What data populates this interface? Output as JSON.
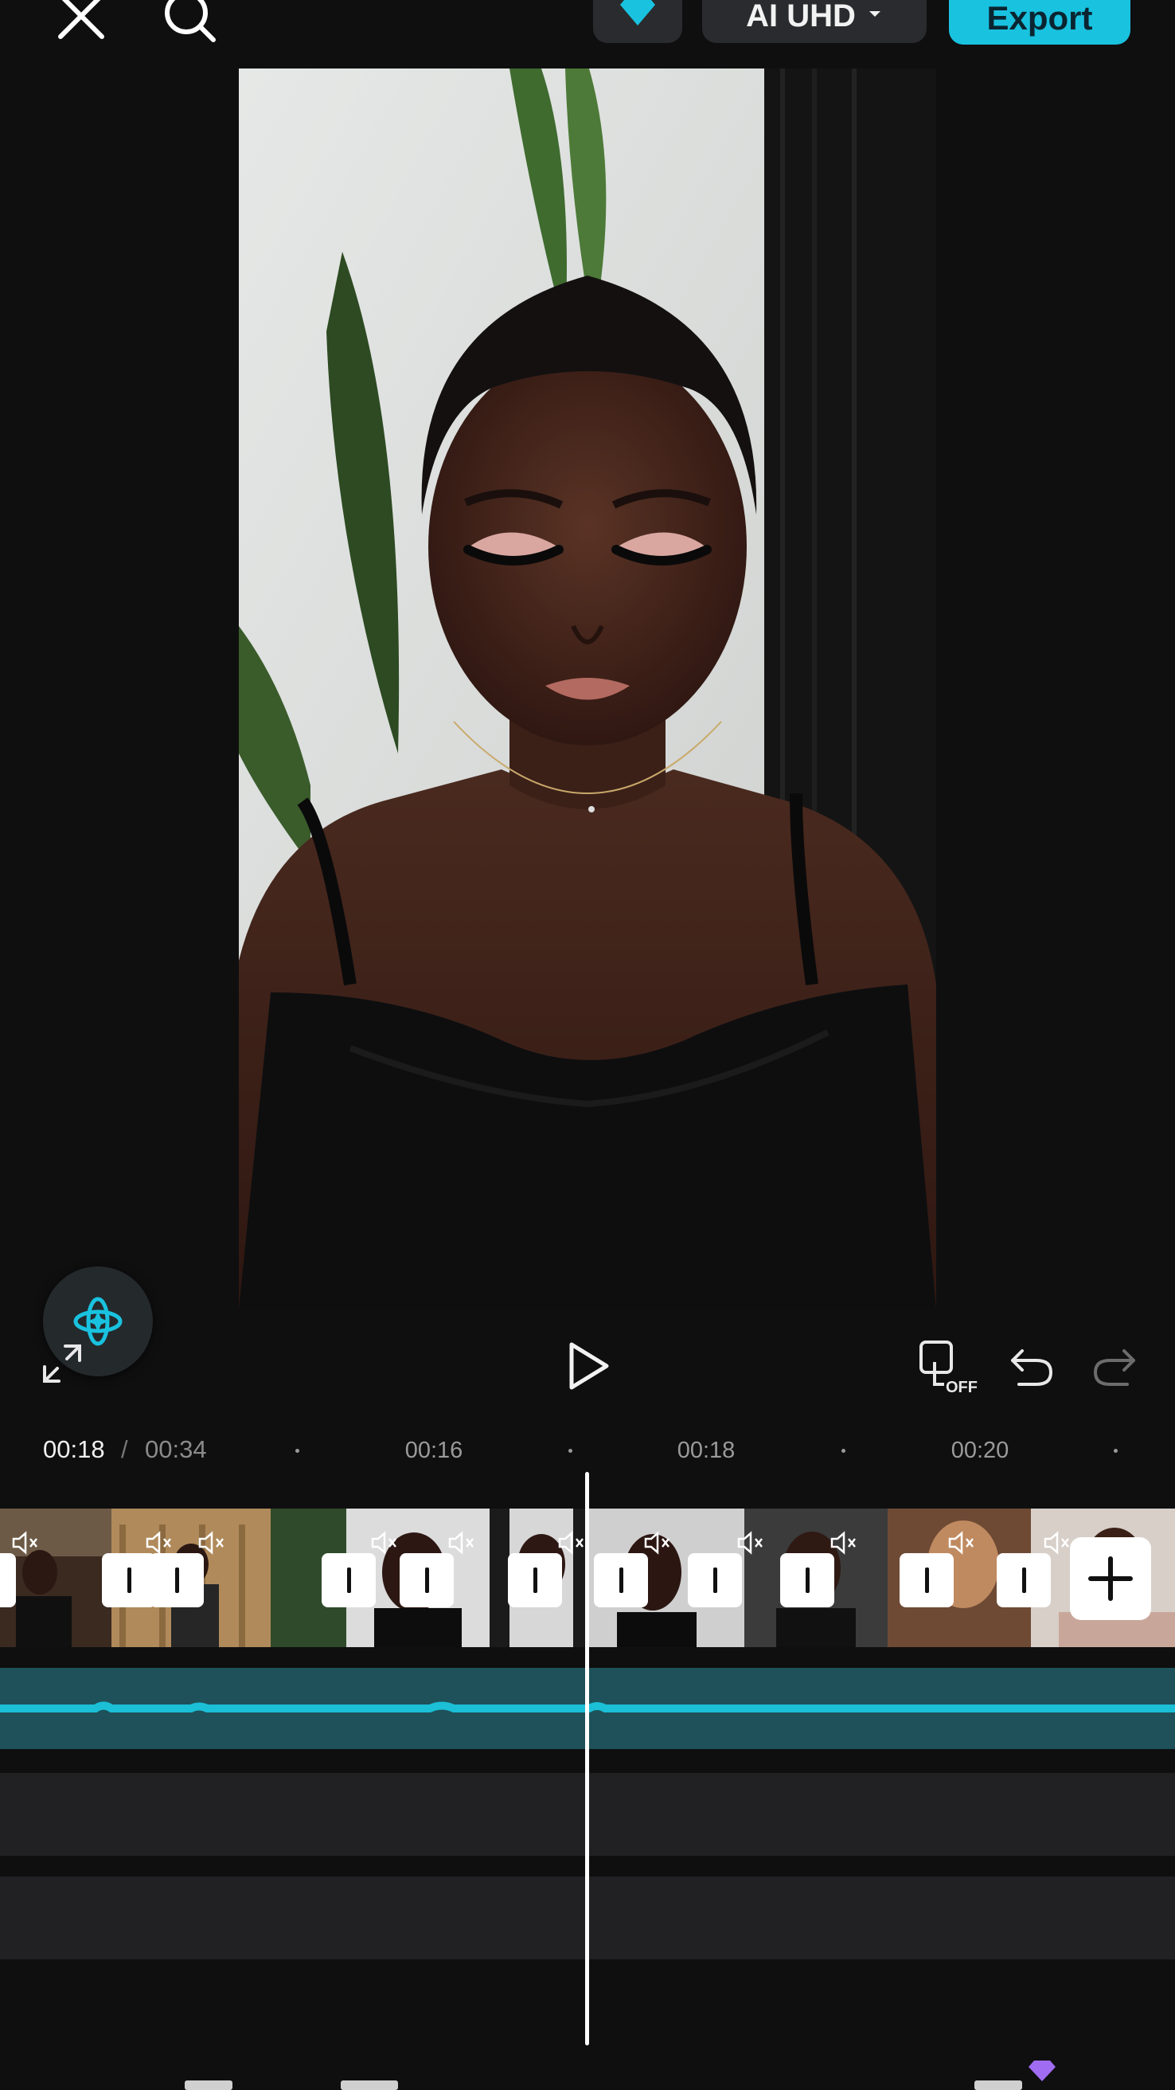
{
  "toolbar": {
    "resolution_label": "AI UHD",
    "export_label": "Export"
  },
  "timeline": {
    "current_time": "00:18",
    "separator": "/",
    "total_time": "00:34",
    "ruler_labels": [
      "00:16",
      "00:18",
      "00:20"
    ]
  },
  "controls": {
    "keyframe_state": "OFF"
  },
  "colors": {
    "accent": "#19c2df",
    "audio_track": "#1e5159",
    "waveform": "#1bbfd6",
    "pro_gem": "#a06cf2"
  },
  "icons": [
    "close-icon",
    "search-icon",
    "diamond-icon",
    "chevron-down-icon",
    "ai-sparkle-icon",
    "fullscreen-icon",
    "play-icon",
    "keyframe-icon",
    "undo-icon",
    "redo-icon",
    "mute-icon",
    "plus-icon"
  ]
}
